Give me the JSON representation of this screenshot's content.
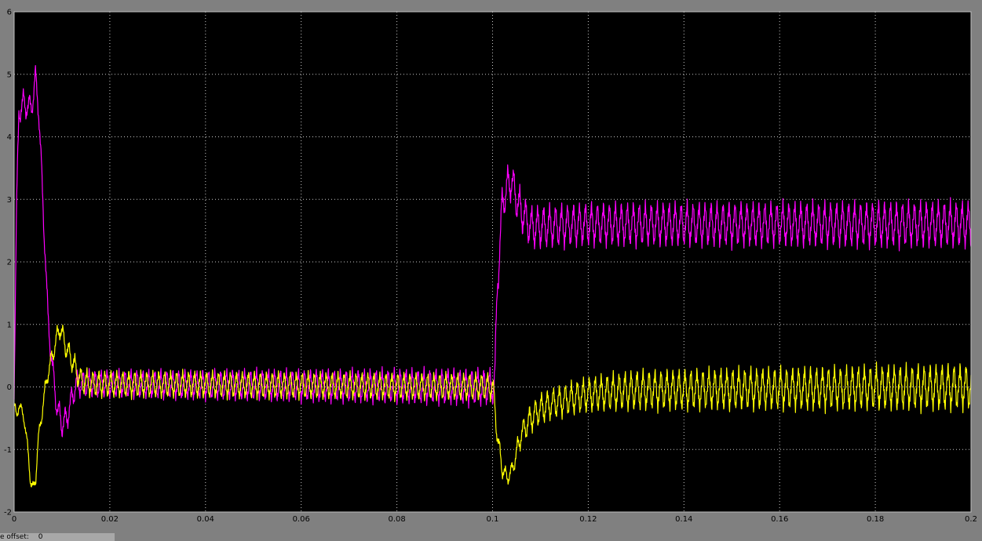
{
  "chart_data": {
    "type": "line",
    "title": "",
    "xlabel": "",
    "ylabel": "",
    "xlim": [
      0,
      0.2
    ],
    "ylim": [
      -2,
      6
    ],
    "x_ticks": [
      0,
      0.02,
      0.04,
      0.06,
      0.08,
      0.1,
      0.12,
      0.14,
      0.16,
      0.18,
      0.2
    ],
    "x_tick_labels": [
      "0",
      "0.02",
      "0.04",
      "0.06",
      "0.08",
      "0.1",
      "0.12",
      "0.14",
      "0.16",
      "0.18",
      "0.2"
    ],
    "y_ticks": [
      -2,
      -1,
      0,
      1,
      2,
      3,
      4,
      5,
      6
    ],
    "y_tick_labels": [
      "-2",
      "-1",
      "0",
      "1",
      "2",
      "3",
      "4",
      "5",
      "6"
    ],
    "grid": true,
    "grid_style": "dotted",
    "background_color": "#000000",
    "frame_color": "#808080",
    "series": [
      {
        "color": "#ff00ff",
        "ripple_period": 0.00125,
        "ripple_amplitude": [
          [
            0,
            0.2
          ],
          [
            0.013,
            0.2
          ],
          [
            0.1,
            0.28
          ],
          [
            0.108,
            0.32
          ],
          [
            0.2,
            0.35
          ]
        ],
        "points": [
          [
            0,
            0.0
          ],
          [
            0.0005,
            2.8
          ],
          [
            0.001,
            4.4
          ],
          [
            0.002,
            4.55
          ],
          [
            0.003,
            4.45
          ],
          [
            0.004,
            4.6
          ],
          [
            0.0045,
            4.95
          ],
          [
            0.005,
            4.6
          ],
          [
            0.006,
            3.0
          ],
          [
            0.007,
            1.2
          ],
          [
            0.008,
            0.3
          ],
          [
            0.009,
            -0.35
          ],
          [
            0.0095,
            -0.45
          ],
          [
            0.01,
            -0.6
          ],
          [
            0.011,
            -0.5
          ],
          [
            0.012,
            -0.2
          ],
          [
            0.013,
            0.05
          ],
          [
            0.015,
            0.05
          ],
          [
            0.1,
            0.0
          ],
          [
            0.1005,
            0.2
          ],
          [
            0.101,
            1.6
          ],
          [
            0.102,
            2.9
          ],
          [
            0.103,
            3.2
          ],
          [
            0.104,
            3.3
          ],
          [
            0.105,
            3.0
          ],
          [
            0.106,
            2.8
          ],
          [
            0.108,
            2.55
          ],
          [
            0.12,
            2.6
          ],
          [
            0.2,
            2.6
          ]
        ]
      },
      {
        "color": "#ffff00",
        "ripple_period": 0.00125,
        "ripple_amplitude": [
          [
            0,
            0.08
          ],
          [
            0.008,
            0.15
          ],
          [
            0.013,
            0.2
          ],
          [
            0.1,
            0.2
          ],
          [
            0.103,
            0.12
          ],
          [
            0.108,
            0.22
          ],
          [
            0.13,
            0.3
          ],
          [
            0.2,
            0.35
          ]
        ],
        "points": [
          [
            0,
            -0.3
          ],
          [
            0.0005,
            -0.45
          ],
          [
            0.001,
            -0.3
          ],
          [
            0.002,
            -0.45
          ],
          [
            0.003,
            -1.1
          ],
          [
            0.0035,
            -1.55
          ],
          [
            0.004,
            -1.65
          ],
          [
            0.0045,
            -1.45
          ],
          [
            0.005,
            -0.9
          ],
          [
            0.006,
            -0.3
          ],
          [
            0.007,
            0.2
          ],
          [
            0.008,
            0.5
          ],
          [
            0.009,
            0.8
          ],
          [
            0.0095,
            0.95
          ],
          [
            0.01,
            0.85
          ],
          [
            0.011,
            0.6
          ],
          [
            0.012,
            0.45
          ],
          [
            0.013,
            0.25
          ],
          [
            0.014,
            0.1
          ],
          [
            0.016,
            0.05
          ],
          [
            0.1,
            0.0
          ],
          [
            0.1005,
            -0.3
          ],
          [
            0.101,
            -0.8
          ],
          [
            0.102,
            -1.3
          ],
          [
            0.103,
            -1.45
          ],
          [
            0.104,
            -1.35
          ],
          [
            0.105,
            -1.05
          ],
          [
            0.106,
            -0.75
          ],
          [
            0.108,
            -0.5
          ],
          [
            0.11,
            -0.35
          ],
          [
            0.113,
            -0.25
          ],
          [
            0.12,
            -0.12
          ],
          [
            0.13,
            -0.05
          ],
          [
            0.2,
            0.0
          ]
        ]
      }
    ]
  },
  "status_bar": {
    "label": "e offset:",
    "value": "0"
  }
}
